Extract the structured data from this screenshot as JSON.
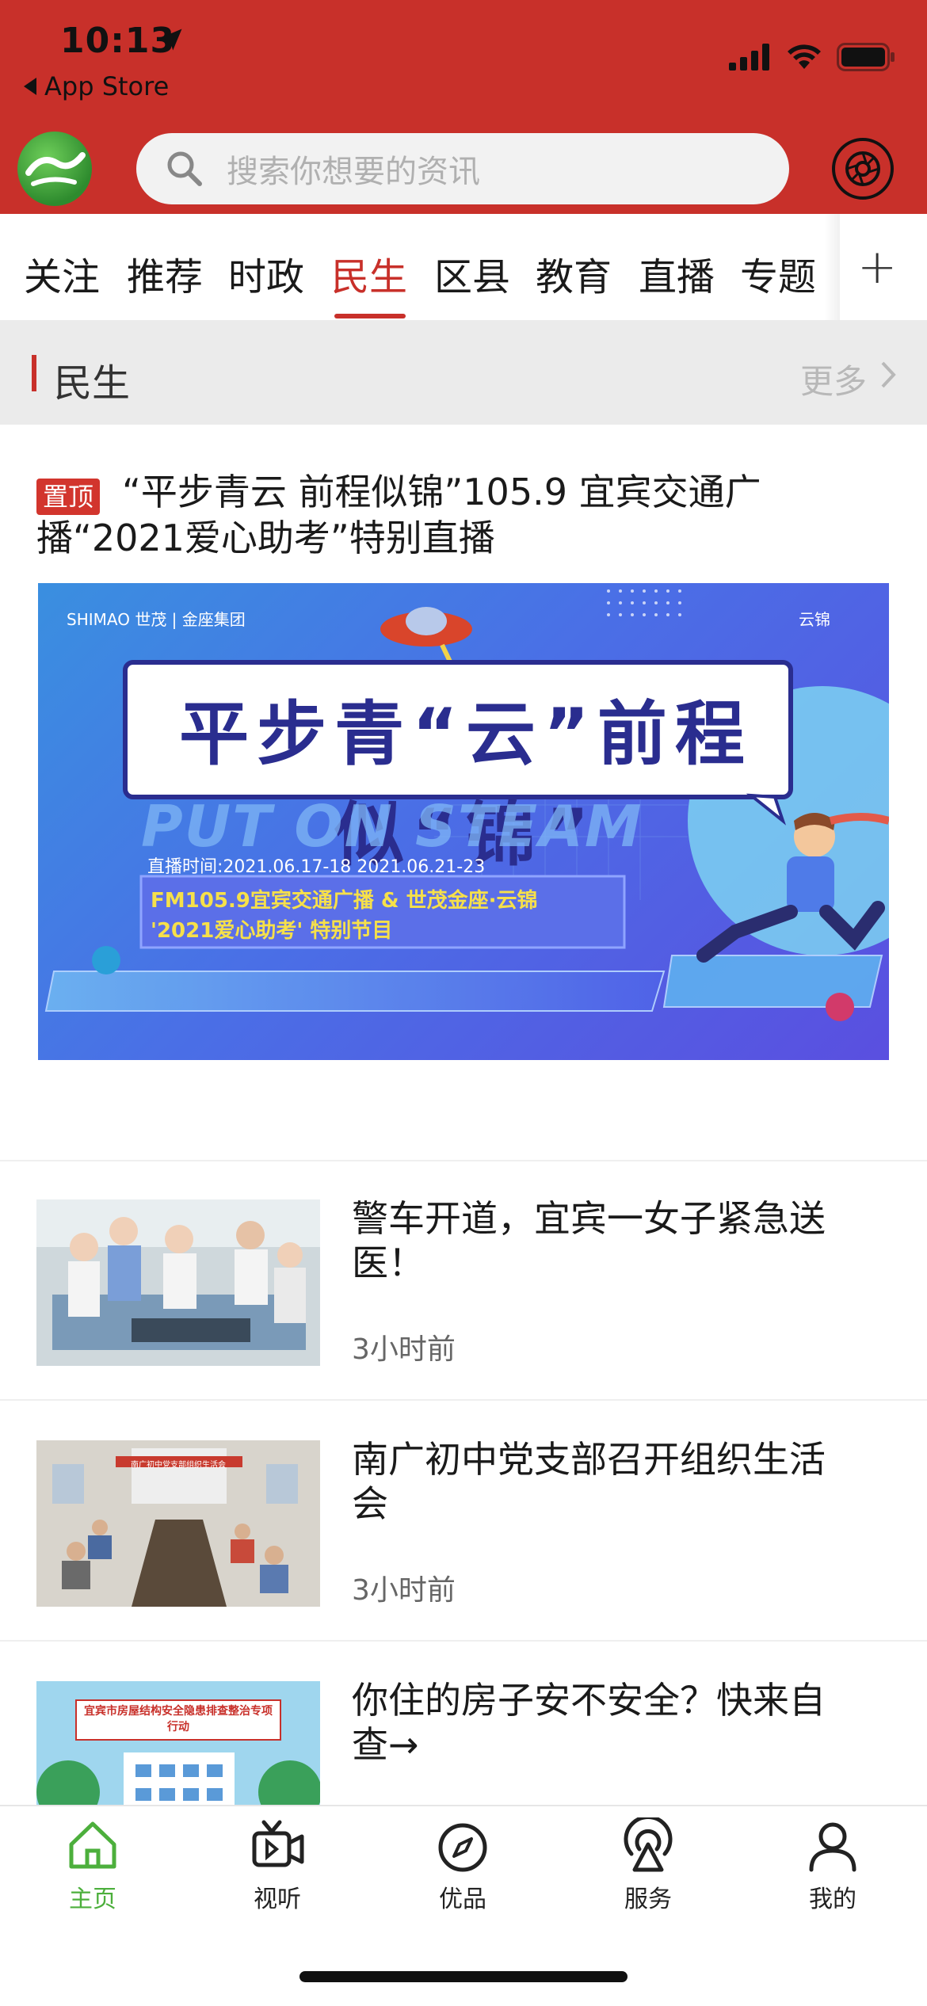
{
  "status_bar": {
    "time": "10:13",
    "back_label": "App Store"
  },
  "header": {
    "search_placeholder": "搜索你想要的资讯"
  },
  "tabs": [
    {
      "label": "关注",
      "active": false
    },
    {
      "label": "推荐",
      "active": false
    },
    {
      "label": "时政",
      "active": false
    },
    {
      "label": "民生",
      "active": true
    },
    {
      "label": "区县",
      "active": false
    },
    {
      "label": "教育",
      "active": false
    },
    {
      "label": "直播",
      "active": false
    },
    {
      "label": "专题",
      "active": false
    }
  ],
  "tabs_add_label": "+",
  "section": {
    "title": "民生",
    "more": "更多"
  },
  "pinned": {
    "badge": "置顶",
    "title": "“平步青云 前程似锦”105.9 宜宾交通广播“2021爱心助考”特别直播",
    "banner": {
      "headline": "平步青“云”前程似“锦”",
      "subtitle": "PUT ON STEAM",
      "brand_left": "SHIMAO 世茂 | 金座集团",
      "brand_right": "云锦",
      "dates": "直播时间:2021.06.17-18   2021.06.21-23",
      "line1": "FM105.9宜宾交通广播 & 世茂金座·云锦",
      "line2": "'2021爱心助考' 特别节目"
    }
  },
  "news": [
    {
      "title": "警车开道，宜宾一女子紧急送医！",
      "time": "3小时前"
    },
    {
      "title": "南广初中党支部召开组织生活会",
      "time": "3小时前",
      "thumb_caption": "南广初中党支部组织生活会"
    },
    {
      "title": "你住的房子安不安全？快来自查→",
      "time": "",
      "thumb_caption": "宜宾市房屋结构安全隐患排查整治专项行动"
    }
  ],
  "bottom_nav": [
    {
      "label": "主页",
      "icon": "home-icon",
      "active": true
    },
    {
      "label": "视听",
      "icon": "video-icon",
      "active": false
    },
    {
      "label": "优品",
      "icon": "compass-icon",
      "active": false
    },
    {
      "label": "服务",
      "icon": "broadcast-icon",
      "active": false
    },
    {
      "label": "我的",
      "icon": "user-icon",
      "active": false
    }
  ],
  "colors": {
    "brand_red": "#c8302a",
    "active_green": "#4caf3c"
  }
}
